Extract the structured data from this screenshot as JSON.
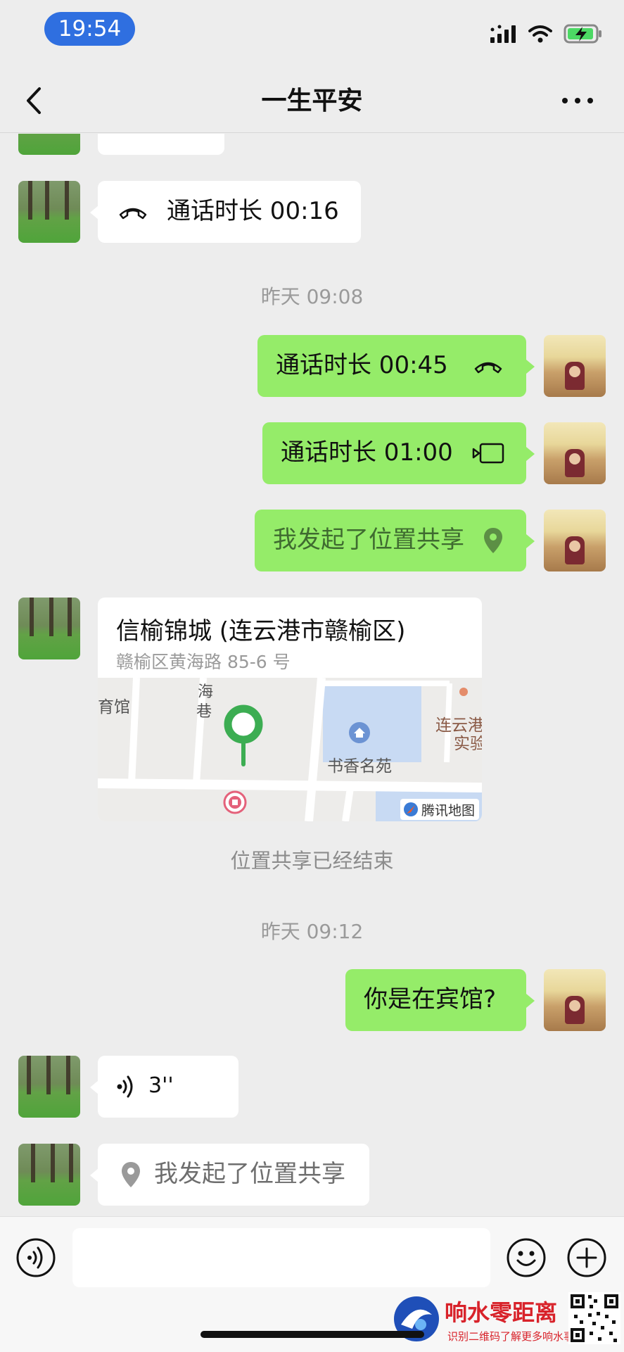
{
  "status": {
    "time": "19:54"
  },
  "nav": {
    "title": "一生平安"
  },
  "messages": {
    "call_in": "通话时长 00:16",
    "stamp1": "昨天 09:08",
    "call_out_voice": "通话时长 00:45",
    "call_out_video": "通话时长 01:00",
    "share_out": "我发起了位置共享",
    "location": {
      "title": "信榆锦城 (连云港市赣榆区)",
      "address": "赣榆区黄海路 85-6 号",
      "map_labels": [
        "育馆",
        "海",
        "巷",
        "书香名苑",
        "连云港",
        "实验",
        "腾讯地图"
      ]
    },
    "share_ended": "位置共享已经结束",
    "stamp2": "昨天 09:12",
    "text_out": "你是在宾馆?",
    "voice_in": "3''",
    "share_in": "我发起了位置共享"
  },
  "watermark": {
    "brand": "响水零距离",
    "slogan": "识别二维码了解更多响水事"
  },
  "colors": {
    "green_bubble": "#95EC69",
    "background": "#EDEDED",
    "time_pill": "#2F6FE0"
  }
}
